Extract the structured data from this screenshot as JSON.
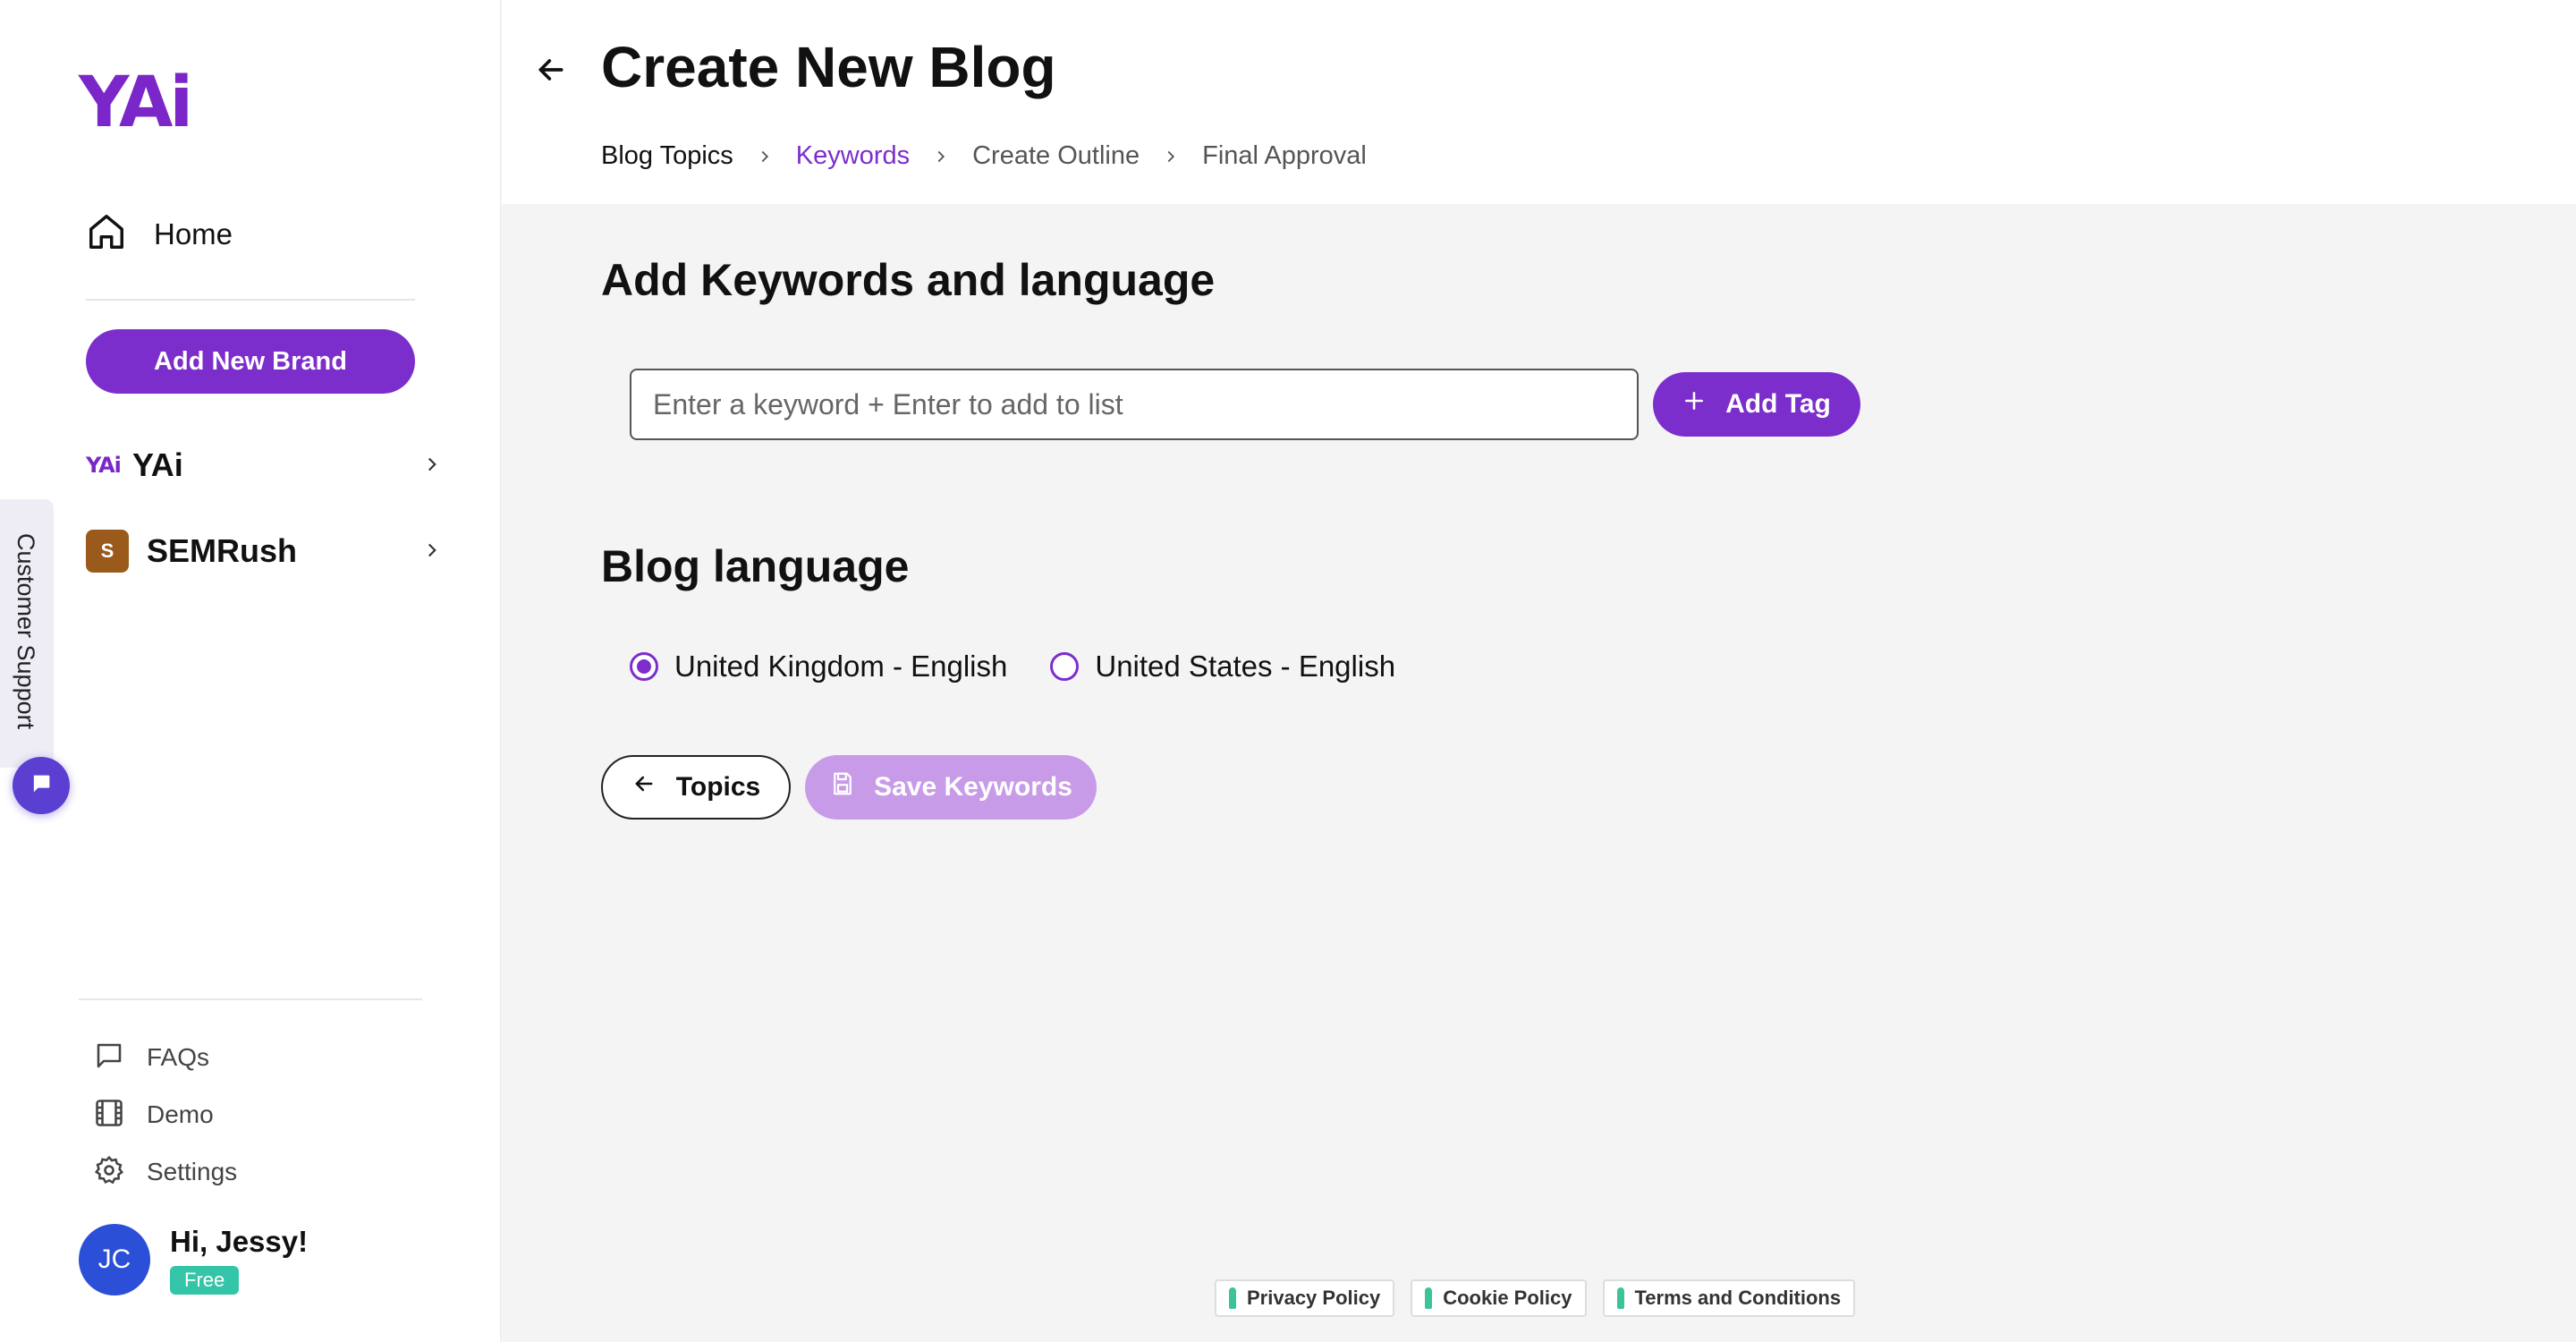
{
  "sidebar": {
    "logo": "YAi",
    "home_label": "Home",
    "add_brand_label": "Add New Brand",
    "brands": [
      {
        "name": "YAi",
        "mini": "YAi"
      },
      {
        "name": "SEMRush",
        "badge": "S"
      }
    ],
    "bottom_links": [
      {
        "label": "FAQs",
        "icon": "chat-bubble-icon"
      },
      {
        "label": "Demo",
        "icon": "film-icon"
      },
      {
        "label": "Settings",
        "icon": "gear-icon"
      }
    ],
    "user": {
      "initials": "JC",
      "greeting": "Hi, Jessy!",
      "plan": "Free"
    }
  },
  "support": {
    "label": "Customer Support"
  },
  "header": {
    "title": "Create New Blog",
    "breadcrumbs": [
      "Blog Topics",
      "Keywords",
      "Create Outline",
      "Final Approval"
    ],
    "active_step": 1
  },
  "main": {
    "keywords_heading": "Add Keywords and language",
    "keyword_input": {
      "value": "",
      "placeholder": "Enter a keyword + Enter to add to list"
    },
    "add_tag_label": "Add Tag",
    "language_heading": "Blog language",
    "languages": [
      {
        "label": "United Kingdom - English",
        "selected": true
      },
      {
        "label": "United States - English",
        "selected": false
      }
    ],
    "topics_button": "Topics",
    "save_button": "Save Keywords"
  },
  "footer": {
    "links": [
      "Privacy Policy",
      "Cookie Policy",
      "Terms and Conditions"
    ]
  },
  "colors": {
    "accent": "#7c2ecc",
    "accent_light": "#c89be8",
    "avatar": "#2b4fd7",
    "free_badge": "#34c4a8",
    "semrush_badge": "#9a5a1b"
  }
}
